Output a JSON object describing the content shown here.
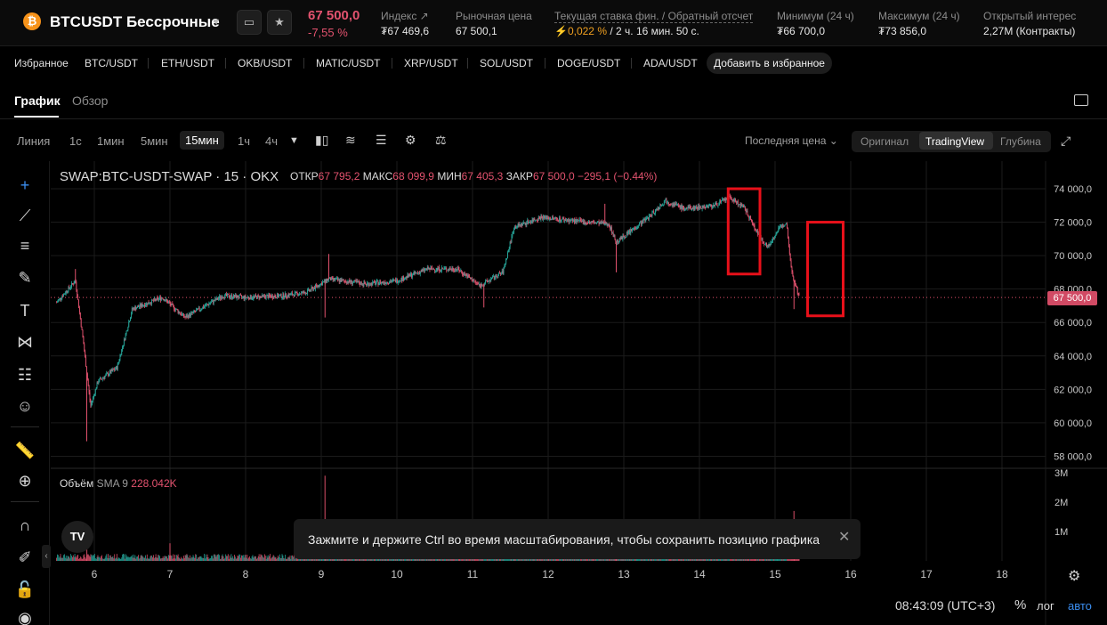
{
  "header": {
    "logo_letter": "₿",
    "symbol": "BTCUSDT Бессрочные",
    "last_price": "67 500,0",
    "change_pct": "-7,55 %",
    "stats": [
      {
        "label": "Индекс",
        "value": "₮67 469,6",
        "icon": "external-link-icon"
      },
      {
        "label": "Рыночная цена",
        "value": "67 500,1"
      },
      {
        "label": "Текущая ставка фин. / Обратный отсчет",
        "value_rate": "0,022 %",
        "value_rest": "/ 2 ч. 16 мин. 50 с."
      },
      {
        "label": "Минимум (24 ч)",
        "value": "₮66 700,0"
      },
      {
        "label": "Максимум (24 ч)",
        "value": "₮73 856,0"
      },
      {
        "label": "Открытый интерес",
        "value": "2,27M (Контракты)"
      }
    ]
  },
  "favorites": {
    "title": "Избранное",
    "items": [
      "BTC/USDT",
      "ETH/USDT",
      "OKB/USDT",
      "MATIC/USDT",
      "XRP/USDT",
      "SOL/USDT",
      "DOGE/USDT",
      "ADA/USDT"
    ],
    "add_label": "Добавить в избранное"
  },
  "tabs": {
    "chart": "График",
    "overview": "Обзор"
  },
  "toolbar": {
    "timeframes": [
      "Линия",
      "1с",
      "1мин",
      "5мин",
      "15мин",
      "1ч",
      "4ч"
    ],
    "selected": "15мин",
    "price_type": "Последняя цена",
    "views": [
      "Оригинал",
      "TradingView",
      "Глубина"
    ],
    "active_view": "TradingView"
  },
  "legend": {
    "symbol": "SWAP:BTC-USDT-SWAP · 15 · OKX",
    "open_label": "ОТКР",
    "open": "67 795,2",
    "high_label": "МАКС",
    "high": "68 099,9",
    "low_label": "МИН",
    "low": "67 405,3",
    "close_label": "ЗАКР",
    "close": "67 500,0",
    "change": "−295,1 (−0.44%)"
  },
  "volume": {
    "label": "Объём",
    "sma": "SMA 9",
    "value": "228.042K"
  },
  "current_price_tag": "67 500,0",
  "toast": {
    "message": "Зажмите и держите Ctrl во время масштабирования, чтобы сохранить позицию графика"
  },
  "bottom": {
    "clock": "08:43:09 (UTC+3)",
    "pct": "%",
    "log": "лог",
    "auto": "авто"
  },
  "colors": {
    "up": "#26a69a",
    "down": "#e2526e",
    "accent": "#3b8ef0",
    "highlight": "#e8101a"
  },
  "chart_data": {
    "type": "candlestick",
    "y_ticks": [
      "74 000,0",
      "72 000,0",
      "70 000,0",
      "68 000,0",
      "66 000,0",
      "64 000,0",
      "62 000,0",
      "60 000,0",
      "58 000,0"
    ],
    "ylim": [
      57000,
      75000
    ],
    "volume_ticks": [
      "3M",
      "2M",
      "1M"
    ],
    "x_ticks": [
      "6",
      "7",
      "8",
      "9",
      "10",
      "11",
      "12",
      "13",
      "14",
      "15",
      "16",
      "17",
      "18"
    ],
    "price_path": [
      {
        "x": 5.5,
        "y": 67200
      },
      {
        "x": 5.75,
        "y": 68500
      },
      {
        "x": 5.85,
        "y": 65000
      },
      {
        "x": 5.95,
        "y": 61000
      },
      {
        "x": 6.05,
        "y": 62500
      },
      {
        "x": 6.3,
        "y": 63300
      },
      {
        "x": 6.5,
        "y": 66800
      },
      {
        "x": 6.9,
        "y": 67500
      },
      {
        "x": 7.2,
        "y": 66300
      },
      {
        "x": 7.7,
        "y": 67600
      },
      {
        "x": 8.0,
        "y": 67500
      },
      {
        "x": 8.5,
        "y": 67600
      },
      {
        "x": 8.8,
        "y": 67800
      },
      {
        "x": 9.1,
        "y": 68600
      },
      {
        "x": 9.6,
        "y": 68300
      },
      {
        "x": 10.0,
        "y": 68500
      },
      {
        "x": 10.4,
        "y": 69200
      },
      {
        "x": 10.8,
        "y": 69200
      },
      {
        "x": 11.1,
        "y": 68200
      },
      {
        "x": 11.4,
        "y": 69000
      },
      {
        "x": 11.55,
        "y": 71700
      },
      {
        "x": 11.9,
        "y": 72300
      },
      {
        "x": 12.5,
        "y": 72000
      },
      {
        "x": 12.8,
        "y": 71900
      },
      {
        "x": 12.9,
        "y": 70800
      },
      {
        "x": 13.1,
        "y": 71500
      },
      {
        "x": 13.35,
        "y": 72400
      },
      {
        "x": 13.55,
        "y": 73300
      },
      {
        "x": 13.8,
        "y": 72800
      },
      {
        "x": 14.2,
        "y": 73000
      },
      {
        "x": 14.4,
        "y": 73500
      },
      {
        "x": 14.6,
        "y": 72800
      },
      {
        "x": 14.75,
        "y": 71500
      },
      {
        "x": 14.9,
        "y": 70500
      },
      {
        "x": 15.05,
        "y": 71600
      },
      {
        "x": 15.15,
        "y": 72000
      },
      {
        "x": 15.22,
        "y": 69000
      },
      {
        "x": 15.32,
        "y": 67500
      }
    ],
    "spikes": [
      {
        "x": 5.9,
        "y": 58900
      },
      {
        "x": 5.75,
        "y": 69200
      },
      {
        "x": 9.1,
        "y": 70100
      },
      {
        "x": 9.05,
        "y": 66300
      },
      {
        "x": 11.15,
        "y": 66900
      },
      {
        "x": 12.75,
        "y": 73100
      },
      {
        "x": 12.9,
        "y": 69000
      },
      {
        "x": 15.25,
        "y": 66800
      }
    ],
    "volume_spikes": [
      {
        "x": 5.9,
        "y": 0.95
      },
      {
        "x": 9.05,
        "y": 2.9
      },
      {
        "x": 12.9,
        "y": 1.3
      },
      {
        "x": 15.25,
        "y": 1.7
      },
      {
        "x": 11.55,
        "y": 1.0
      },
      {
        "x": 7.0,
        "y": 0.6
      }
    ],
    "highlight_boxes": [
      {
        "x0": 14.38,
        "x1": 14.8,
        "y_top": 74000,
        "y_bottom": 68900
      },
      {
        "x0": 15.43,
        "x1": 15.9,
        "y_top": 72000,
        "y_bottom": 66400
      }
    ]
  }
}
